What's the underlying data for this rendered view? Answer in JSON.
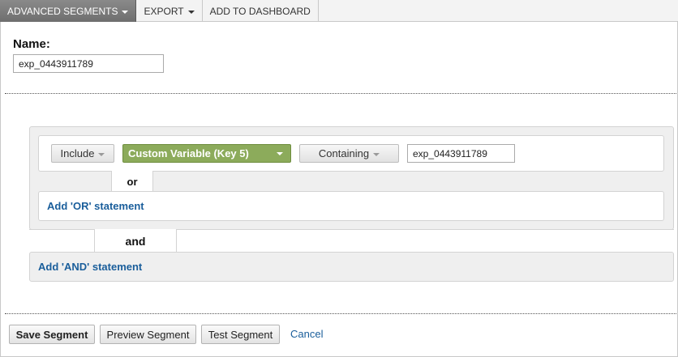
{
  "toolbar": {
    "advanced_segments": "ADVANCED SEGMENTS",
    "export": "EXPORT",
    "add_to_dashboard": "ADD TO DASHBOARD"
  },
  "segment": {
    "name_label": "Name:",
    "name_value": "exp_0443911789"
  },
  "condition": {
    "include_label": "Include",
    "dimension_label": "Custom Variable (Key 5)",
    "match_label": "Containing",
    "value": "exp_0443911789"
  },
  "connectors": {
    "or_label": "or",
    "and_label": "and"
  },
  "links": {
    "add_or": "Add 'OR' statement",
    "add_and": "Add 'AND' statement"
  },
  "actions": {
    "save": "Save Segment",
    "preview": "Preview Segment",
    "test": "Test Segment",
    "cancel": "Cancel"
  },
  "colors": {
    "dimension_green": "#8cab5b",
    "link_blue": "#1a5e9b",
    "active_tab": "#7a7a7a"
  }
}
